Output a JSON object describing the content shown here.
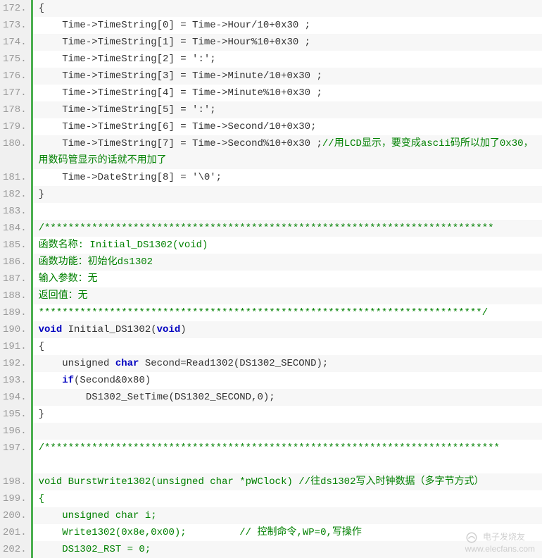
{
  "lines": [
    {
      "n": "172.",
      "bg": "odd",
      "parts": [
        {
          "c": "plain",
          "t": "{"
        }
      ]
    },
    {
      "n": "173.",
      "bg": "even",
      "parts": [
        {
          "c": "plain",
          "t": "    Time->TimeString[0] = Time->Hour/10+0x30 ;"
        }
      ]
    },
    {
      "n": "174.",
      "bg": "odd",
      "parts": [
        {
          "c": "plain",
          "t": "    Time->TimeString[1] = Time->Hour%10+0x30 ;"
        }
      ]
    },
    {
      "n": "175.",
      "bg": "even",
      "parts": [
        {
          "c": "plain",
          "t": "    Time->TimeString[2] = ':';"
        }
      ]
    },
    {
      "n": "176.",
      "bg": "odd",
      "parts": [
        {
          "c": "plain",
          "t": "    Time->TimeString[3] = Time->Minute/10+0x30 ;"
        }
      ]
    },
    {
      "n": "177.",
      "bg": "even",
      "parts": [
        {
          "c": "plain",
          "t": "    Time->TimeString[4] = Time->Minute%10+0x30 ;"
        }
      ]
    },
    {
      "n": "178.",
      "bg": "odd",
      "parts": [
        {
          "c": "plain",
          "t": "    Time->TimeString[5] = ':';"
        }
      ]
    },
    {
      "n": "179.",
      "bg": "even",
      "parts": [
        {
          "c": "plain",
          "t": "    Time->TimeString[6] = Time->Second/10+0x30;"
        }
      ]
    },
    {
      "n": "180.",
      "bg": "odd",
      "wrap": true,
      "parts": [
        {
          "c": "plain",
          "t": "    Time->TimeString[7] = Time->Second%10+0x30 ;"
        },
        {
          "c": "cmt",
          "t": "//用LCD显示，要变成ascii码所以加了0x30，用数码管显示的话就不用加了"
        }
      ]
    },
    {
      "n": "181.",
      "bg": "even",
      "parts": [
        {
          "c": "plain",
          "t": "    Time->DateString[8] = '\\0';"
        }
      ]
    },
    {
      "n": "182.",
      "bg": "odd",
      "parts": [
        {
          "c": "plain",
          "t": "}"
        }
      ]
    },
    {
      "n": "183.",
      "bg": "even",
      "parts": [
        {
          "c": "plain",
          "t": "  "
        }
      ]
    },
    {
      "n": "184.",
      "bg": "odd",
      "parts": [
        {
          "c": "cmt",
          "t": "/****************************************************************************"
        }
      ]
    },
    {
      "n": "185.",
      "bg": "even",
      "parts": [
        {
          "c": "cmt",
          "t": "函数名称: Initial_DS1302(void)"
        }
      ]
    },
    {
      "n": "186.",
      "bg": "odd",
      "parts": [
        {
          "c": "cmt",
          "t": "函数功能：初始化ds1302"
        }
      ]
    },
    {
      "n": "187.",
      "bg": "even",
      "parts": [
        {
          "c": "cmt",
          "t": "输入参数：无"
        }
      ]
    },
    {
      "n": "188.",
      "bg": "odd",
      "parts": [
        {
          "c": "cmt",
          "t": "返回值：无"
        }
      ]
    },
    {
      "n": "189.",
      "bg": "even",
      "parts": [
        {
          "c": "cmt",
          "t": "***************************************************************************/"
        }
      ]
    },
    {
      "n": "190.",
      "bg": "odd",
      "parts": [
        {
          "c": "kw",
          "t": "void"
        },
        {
          "c": "plain",
          "t": " Initial_DS1302("
        },
        {
          "c": "kw",
          "t": "void"
        },
        {
          "c": "plain",
          "t": ")"
        }
      ]
    },
    {
      "n": "191.",
      "bg": "even",
      "parts": [
        {
          "c": "plain",
          "t": "{"
        }
      ]
    },
    {
      "n": "192.",
      "bg": "odd",
      "parts": [
        {
          "c": "plain",
          "t": "    unsigned "
        },
        {
          "c": "kw",
          "t": "char"
        },
        {
          "c": "plain",
          "t": " Second=Read1302(DS1302_SECOND);"
        }
      ]
    },
    {
      "n": "193.",
      "bg": "even",
      "parts": [
        {
          "c": "kw",
          "t": "    if"
        },
        {
          "c": "plain",
          "t": "(Second&0x80)"
        }
      ]
    },
    {
      "n": "194.",
      "bg": "odd",
      "parts": [
        {
          "c": "plain",
          "t": "        DS1302_SetTime(DS1302_SECOND,0);"
        }
      ]
    },
    {
      "n": "195.",
      "bg": "even",
      "parts": [
        {
          "c": "plain",
          "t": "}"
        }
      ]
    },
    {
      "n": "196.",
      "bg": "odd",
      "parts": [
        {
          "c": "plain",
          "t": "  "
        }
      ]
    },
    {
      "n": "197.",
      "bg": "even",
      "wrap": true,
      "parts": [
        {
          "c": "cmt",
          "t": "/*****************************************************************************"
        }
      ]
    },
    {
      "n": "198.",
      "bg": "odd",
      "parts": [
        {
          "c": "cmt",
          "t": "void BurstWrite1302(unsigned char *pWClock) //往ds1302写入时钟数据（多字节方式）"
        }
      ]
    },
    {
      "n": "199.",
      "bg": "even",
      "parts": [
        {
          "c": "cmt",
          "t": "{"
        }
      ]
    },
    {
      "n": "200.",
      "bg": "odd",
      "parts": [
        {
          "c": "cmt",
          "t": "    unsigned char i;"
        }
      ]
    },
    {
      "n": "201.",
      "bg": "even",
      "parts": [
        {
          "c": "cmt",
          "t": "    Write1302(0x8e,0x00);         // 控制命令,WP=0,写操作"
        }
      ]
    },
    {
      "n": "202.",
      "bg": "odd",
      "parts": [
        {
          "c": "cmt",
          "t": "    DS1302_RST = 0;"
        }
      ]
    }
  ],
  "watermark": {
    "brand": "电子发烧友",
    "url": "www.elecfans.com"
  }
}
